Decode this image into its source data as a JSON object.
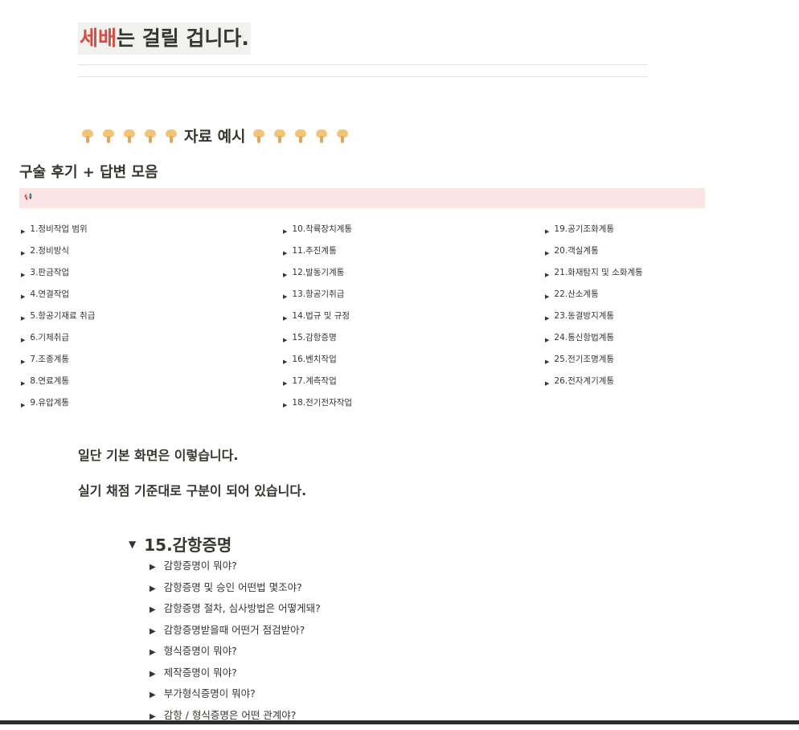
{
  "heading": {
    "highlight": "세배",
    "rest": "는 걸릴 겁니다."
  },
  "example": {
    "label": "자료 예시",
    "hand_icon": "backhand-index-pointing-down-icon"
  },
  "section_title": "구술 후기 + 답변 모음",
  "callout_icon": "megaphone-icon",
  "toc": {
    "col1": [
      "1.정비작업 범위",
      "2.정비방식",
      "3.판금작업",
      "4.연결작업",
      "5.항공기재료 취급",
      "6.기체취급",
      "7.조종계통",
      "8.연료계통",
      "9.유압계통"
    ],
    "col2": [
      "10.착륙장치계통",
      "11.추진계통",
      "12.발동기계통",
      "13.항공기취급",
      "14.법규 및 규정",
      "15.감항증명",
      "16.벤치작업",
      "17.계측작업",
      "18.전기전자작업"
    ],
    "col3": [
      "19.공기조화계통",
      "20.객실계통",
      "21.화재탐지 및 소화계통",
      "22.산소계통",
      "23.동결방지계통",
      "24.통신항법계통",
      "25.전기조명계통",
      "26.전자계기계통"
    ]
  },
  "paragraphs": [
    "일단 기본 화면은 이렇습니다.",
    "실기 채점 기준대로 구분이 되어 있습니다."
  ],
  "toggle": {
    "title": "15.감항증명",
    "items": [
      "감항증명이 뭐야?",
      "감항증명 및 승인 어떤법 몇조야?",
      "감항증명 절차, 심사방법은 어떻게돼?",
      "감항증명받을때 어떤거 점검받아?",
      "형식증명이 뭐야?",
      "제작증명이 뭐야?",
      "부가형식증명이 뭐야?",
      "감항 / 형식증명은 어떤 관계야?"
    ]
  }
}
